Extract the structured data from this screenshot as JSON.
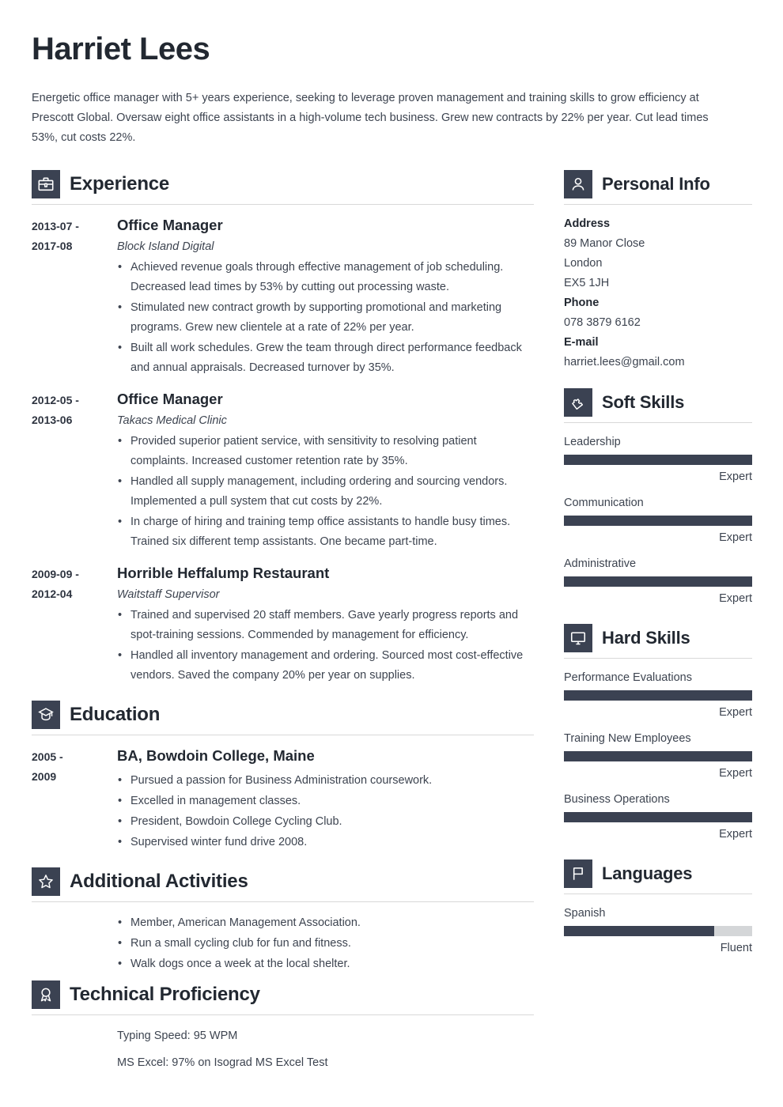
{
  "header": {
    "name": "Harriet Lees",
    "summary": "Energetic office manager with 5+ years experience, seeking to leverage proven management and training skills to grow efficiency at Prescott Global. Oversaw eight office assistants in a high-volume tech business. Grew new contracts by 22% per year. Cut lead times 53%, cut costs 22%."
  },
  "theme": {
    "icon_bg": "#3b4252",
    "text": "#3d4450",
    "heading": "#222831",
    "divider": "#d8d8d8",
    "bar_track": "#d4d6d8",
    "bar_fill": "#3b4252"
  },
  "main": {
    "experience": {
      "title": "Experience",
      "icon": "briefcase-icon",
      "entries": [
        {
          "dates": "2013-07 - 2017-08",
          "title": "Office Manager",
          "subtitle": "Block Island Digital",
          "bullets": [
            "Achieved revenue goals through effective management of job scheduling. Decreased lead times by 53% by cutting out processing waste.",
            "Stimulated new contract growth by supporting promotional and marketing programs. Grew new clientele at a rate of 22% per year.",
            "Built all work schedules. Grew the team through direct performance feedback and annual appraisals. Decreased turnover by 35%."
          ]
        },
        {
          "dates": "2012-05 - 2013-06",
          "title": "Office Manager",
          "subtitle": "Takacs Medical Clinic",
          "bullets": [
            "Provided superior patient service, with sensitivity to resolving patient complaints. Increased customer retention rate by 35%.",
            "Handled all supply management, including ordering and sourcing vendors. Implemented a pull system that cut costs by 22%.",
            "In charge of hiring and training temp office assistants to handle busy times. Trained six different temp assistants. One became part-time."
          ]
        },
        {
          "dates": "2009-09 - 2012-04",
          "title": "Horrible Heffalump Restaurant",
          "subtitle": "Waitstaff Supervisor",
          "bullets": [
            "Trained and supervised 20 staff members. Gave yearly progress reports and spot-training sessions. Commended by management for efficiency.",
            "Handled all inventory management and ordering. Sourced most cost-effective vendors. Saved the company 20% per year on supplies."
          ]
        }
      ]
    },
    "education": {
      "title": "Education",
      "icon": "graduation-cap-icon",
      "entries": [
        {
          "dates": "2005 - 2009",
          "title": "BA, Bowdoin College, Maine",
          "bullets": [
            "Pursued a passion for Business Administration coursework.",
            "Excelled in management classes.",
            "President, Bowdoin College Cycling Club.",
            "Supervised winter fund drive 2008."
          ]
        }
      ]
    },
    "activities": {
      "title": "Additional Activities",
      "icon": "star-icon",
      "bullets": [
        "Member, American Management Association.",
        "Run a small cycling club for fun and fitness.",
        "Walk dogs once a week at the local shelter."
      ]
    },
    "technical": {
      "title": "Technical Proficiency",
      "icon": "award-icon",
      "lines": [
        "Typing Speed: 95 WPM",
        "MS Excel: 97% on Isograd MS Excel Test"
      ]
    }
  },
  "sidebar": {
    "personal_info": {
      "title": "Personal Info",
      "icon": "person-icon",
      "fields": [
        {
          "label": "Address",
          "values": [
            "89 Manor Close",
            "London",
            "EX5 1JH"
          ]
        },
        {
          "label": "Phone",
          "values": [
            "078 3879 6162"
          ]
        },
        {
          "label": "E-mail",
          "values": [
            "harriet.lees@gmail.com"
          ]
        }
      ]
    },
    "soft_skills": {
      "title": "Soft Skills",
      "icon": "puzzle-icon",
      "skills": [
        {
          "name": "Leadership",
          "level": "Expert",
          "percent": 100
        },
        {
          "name": "Communication",
          "level": "Expert",
          "percent": 100
        },
        {
          "name": "Administrative",
          "level": "Expert",
          "percent": 100
        }
      ]
    },
    "hard_skills": {
      "title": "Hard Skills",
      "icon": "monitor-icon",
      "skills": [
        {
          "name": "Performance Evaluations",
          "level": "Expert",
          "percent": 100
        },
        {
          "name": "Training New Employees",
          "level": "Expert",
          "percent": 100
        },
        {
          "name": "Business Operations",
          "level": "Expert",
          "percent": 100
        }
      ]
    },
    "languages": {
      "title": "Languages",
      "icon": "flag-icon",
      "skills": [
        {
          "name": "Spanish",
          "level": "Fluent",
          "percent": 80
        }
      ]
    }
  }
}
